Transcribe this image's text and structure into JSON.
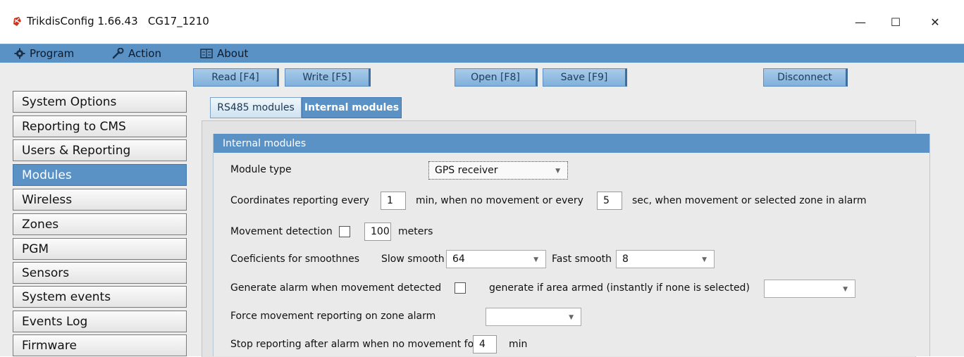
{
  "window": {
    "title": "TrikdisConfig 1.66.43   CG17_1210",
    "app_icon": "trikdis-logo-icon",
    "controls": [
      "minimize-icon",
      "maximize-icon",
      "close-icon"
    ],
    "minimize_glyph": "—",
    "maximize_glyph": "☐",
    "close_glyph": "✕"
  },
  "menu": {
    "program": "Program",
    "action": "Action",
    "about": "About"
  },
  "toolbar": {
    "read": "Read [F4]",
    "write": "Write [F5]",
    "open": "Open [F8]",
    "save": "Save [F9]",
    "disconnect": "Disconnect"
  },
  "sidebar": {
    "active_index": 3,
    "items": [
      {
        "label": "System Options"
      },
      {
        "label": "Reporting to CMS"
      },
      {
        "label": "Users & Reporting"
      },
      {
        "label": "Modules"
      },
      {
        "label": "Wireless"
      },
      {
        "label": "Zones"
      },
      {
        "label": "PGM"
      },
      {
        "label": "Sensors"
      },
      {
        "label": "System events"
      },
      {
        "label": "Events Log"
      },
      {
        "label": "Firmware"
      }
    ]
  },
  "tabs": {
    "rs485": "RS485 modules",
    "internal": "Internal modules",
    "active": "internal"
  },
  "group": {
    "title": "Internal modules",
    "module_type_label": "Module type",
    "module_type_value": "GPS receiver",
    "coords_prefix": "Coordinates reporting every",
    "coords_min_value": "1",
    "coords_mid": "min, when no movement or every",
    "coords_sec_value": "5",
    "coords_suffix": "sec, when movement or selected zone in alarm",
    "movement_detection_label": "Movement detection",
    "movement_detection_checked": false,
    "movement_distance_value": "100",
    "meters_label": "meters",
    "coef_label": "Coeficients for smoothnes",
    "slow_smooth_label": "Slow smooth",
    "slow_smooth_value": "64",
    "fast_smooth_label": "Fast smooth",
    "fast_smooth_value": "8",
    "gen_alarm_label": "Generate alarm when movement detected",
    "gen_alarm_checked": false,
    "gen_if_armed_label": "generate if area armed (instantly if none is selected)",
    "gen_if_armed_value": "",
    "force_label": "Force movement reporting on zone alarm",
    "force_value": "",
    "stop_label": "Stop reporting after alarm when no movement for",
    "stop_value": "4",
    "stop_unit": "min"
  },
  "colors": {
    "accent": "#5b92c6",
    "button_top": "#aacbe8",
    "button_bottom": "#7fb0dc",
    "panel_bg": "#eaeaea"
  }
}
